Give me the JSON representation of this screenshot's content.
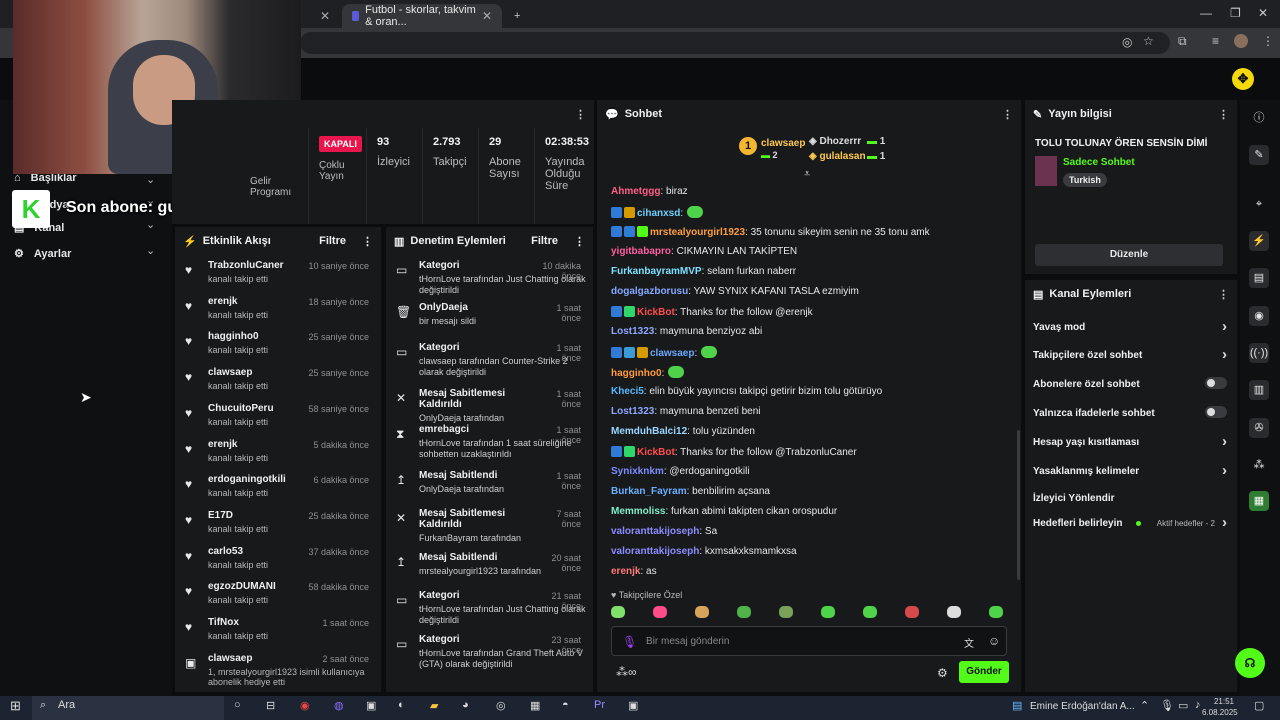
{
  "browser": {
    "tab1_label": "",
    "tab2_label": "Futbol - skorlar, takvim & oran...",
    "new_tab": "+"
  },
  "nav": {
    "items": [
      {
        "label": "Başlıklar"
      },
      {
        "label": "Medya"
      },
      {
        "label": "Kanal"
      },
      {
        "label": "Ayarlar"
      }
    ]
  },
  "overlay": {
    "sub_text": "Son abone: gulalasan",
    "brand_letter": "K"
  },
  "stats": {
    "status": "KAPALI",
    "status_label": "Çoklu Yayın",
    "partial_label": "Gelir Programı",
    "viewers": "93",
    "viewers_label": "İzleyici",
    "followers": "2.793",
    "followers_label": "Takipçi",
    "subs": "29",
    "subs_label": "Abone Sayısı",
    "uptime": "02:38:53",
    "uptime_label": "Yayında Olduğu Süre"
  },
  "activity": {
    "title": "Etkinlik Akışı",
    "filter": "Filtre",
    "rows": [
      {
        "name": "TrabzonluCaner",
        "sub": "kanalı takip etti",
        "time": "10 saniye önce"
      },
      {
        "name": "erenjk",
        "sub": "kanalı takip etti",
        "time": "18 saniye önce"
      },
      {
        "name": "hagginho0",
        "sub": "kanalı takip etti",
        "time": "25 saniye önce"
      },
      {
        "name": "clawsaep",
        "sub": "kanalı takip etti",
        "time": "25 saniye önce"
      },
      {
        "name": "ChucuitoPeru",
        "sub": "kanalı takip etti",
        "time": "58 saniye önce"
      },
      {
        "name": "erenjk",
        "sub": "kanalı takip etti",
        "time": "5 dakika önce"
      },
      {
        "name": "erdoganingotkili",
        "sub": "kanalı takip etti",
        "time": "6 dakika önce"
      },
      {
        "name": "E17D",
        "sub": "kanalı takip etti",
        "time": "25 dakika önce"
      },
      {
        "name": "carlo53",
        "sub": "kanalı takip etti",
        "time": "37 dakika önce"
      },
      {
        "name": "egzozDUMANI",
        "sub": "kanalı takip etti",
        "time": "58 dakika önce"
      },
      {
        "name": "TifNox",
        "sub": "kanalı takip etti",
        "time": "1 saat önce"
      },
      {
        "name": "clawsaep",
        "sub": "1, mrstealyourgirl1923 isimli kullanıcıya abonelik hediye etti",
        "time": "2 saat önce"
      }
    ]
  },
  "moderation": {
    "title": "Denetim Eylemleri",
    "filter": "Filtre",
    "rows": [
      {
        "name": "Kategori",
        "sub": "tHornLove tarafından Just Chatting olarak değiştirildi",
        "time": "10 dakika önce"
      },
      {
        "name": "OnlyDaeja",
        "sub": "bir mesajı sildi",
        "time": "1 saat önce"
      },
      {
        "name": "Kategori",
        "sub": "clawsaep tarafından Counter-Strike 2 olarak değiştirildi",
        "time": "1 saat önce"
      },
      {
        "name": "Mesaj Sabitlemesi Kaldırıldı",
        "sub": "OnlyDaeja tarafından",
        "time": "1 saat önce"
      },
      {
        "name": "emrebagci",
        "sub": "tHornLove tarafından 1 saat süreliğine sohbetten uzaklaştırıldı",
        "time": "1 saat önce"
      },
      {
        "name": "Mesaj Sabitlendi",
        "sub": "OnlyDaeja tarafından",
        "time": "1 saat önce"
      },
      {
        "name": "Mesaj Sabitlemesi Kaldırıldı",
        "sub": "FurkanBayram tarafından",
        "time": "7 saat önce"
      },
      {
        "name": "Mesaj Sabitlendi",
        "sub": "mrstealyourgirl1923 tarafından",
        "time": "20 saat önce"
      },
      {
        "name": "Kategori",
        "sub": "tHornLove tarafından Just Chatting olarak değiştirildi",
        "time": "21 saat önce"
      },
      {
        "name": "Kategori",
        "sub": "tHornLove tarafından Grand Theft Auto V (GTA) olarak değiştirildi",
        "time": "23 saat önce"
      }
    ]
  },
  "chat": {
    "title": "Sohbet",
    "top1": "clawsaep",
    "top1_count": "2",
    "top2": "Dhozerrr",
    "top2_count": "1",
    "top3": "gulalasan",
    "top3_count": "1",
    "lines": [
      {
        "user": "Ahmetggg",
        "color": "#ff5f87",
        "msg": ": biraz"
      },
      {
        "user": "cihanxsd",
        "color": "#6ad0ff",
        "msg": ":"
      },
      {
        "user": "mrstealyourgirl1923",
        "color": "#ff9f40",
        "msg": ": 35 tonunu sikeyim senin ne 35 tonu amk"
      },
      {
        "user": "yigitbabapro",
        "color": "#ff5fa0",
        "msg": ": CIKMAYIN LAN TAKİPTEN"
      },
      {
        "user": "FurkanbayramMVP",
        "color": "#7ee0ff",
        "msg": ": selam furkan naberr"
      },
      {
        "user": "dogalgazborusu",
        "color": "#86a8ff",
        "msg": ": YAW SYNIX KAFANI TASLA ezmiyim"
      },
      {
        "user": "KickBot",
        "color": "#ff4d4d",
        "msg": ": Thanks for the follow @erenjk"
      },
      {
        "user": "Lost1323",
        "color": "#8fa8ff",
        "msg": ": maymuna benziyoz abi"
      },
      {
        "user": "clawsaep",
        "color": "#6aa8ff",
        "msg": ":"
      },
      {
        "user": "hagginho0",
        "color": "#ff9a3d",
        "msg": ":"
      },
      {
        "user": "Kheci5",
        "color": "#56b8ff",
        "msg": ": elin büyük yayıncısı takipçi getirir bizim tolu götürüyo"
      },
      {
        "user": "Lost1323",
        "color": "#8fa8ff",
        "msg": ": maymuna benzeti beni"
      },
      {
        "user": "MemduhBalci12",
        "color": "#9ad7ff",
        "msg": ": tolu yüzünden"
      },
      {
        "user": "KickBot",
        "color": "#ff4d4d",
        "msg": ": Thanks for the follow @TrabzonluCaner"
      },
      {
        "user": "Synixknkm",
        "color": "#7d8dff",
        "msg": ": @erdoganingotkili"
      },
      {
        "user": "Burkan_Fayram",
        "color": "#6ab0ff",
        "msg": ": benbilirim açsana"
      },
      {
        "user": "Memmoliss",
        "color": "#7ef0c8",
        "msg": ": furkan abimi takipten cikan orospudur"
      },
      {
        "user": "valoranttakijoseph",
        "color": "#8b8dff",
        "msg": ": Sa"
      },
      {
        "user": "valoranttakijoseph",
        "color": "#8b8dff",
        "msg": ": kxmsakxksmamkxsa"
      },
      {
        "user": "erenjk",
        "color": "#ff7a7a",
        "msg": ": as"
      }
    ],
    "followers_only": "Takipçilere Özel",
    "placeholder": "Bir mesaj gönderin",
    "send": "Gönder"
  },
  "stream_info": {
    "title": "Yayın bilgisi",
    "stream_title": "TOLU TOLUNAY ÖREN SENSİN DİMİ",
    "category": "Sadece Sohbet",
    "language": "Turkish",
    "edit": "Düzenle"
  },
  "channel_actions": {
    "title": "Kanal Eylemleri",
    "items": [
      {
        "label": "Yavaş mod",
        "kind": "arrow"
      },
      {
        "label": "Takipçilere özel sohbet",
        "kind": "arrow"
      },
      {
        "label": "Abonelere özel sohbet",
        "kind": "toggle"
      },
      {
        "label": "Yalnızca ifadelerle sohbet",
        "kind": "toggle"
      },
      {
        "label": "Hesap yaşı kısıtlaması",
        "kind": "arrow"
      },
      {
        "label": "Yasaklanmış kelimeler",
        "kind": "arrow"
      },
      {
        "label": "İzleyici Yönlendir",
        "kind": "none"
      },
      {
        "label": "Hedefleri belirleyin",
        "kind": "arrow"
      }
    ],
    "goals_status": "Aktif hedefler - 2"
  },
  "taskbar": {
    "search": "Ara",
    "news": "Emine Erdoğan'dan A...",
    "time": "21:51",
    "date": "6.08.2025"
  }
}
